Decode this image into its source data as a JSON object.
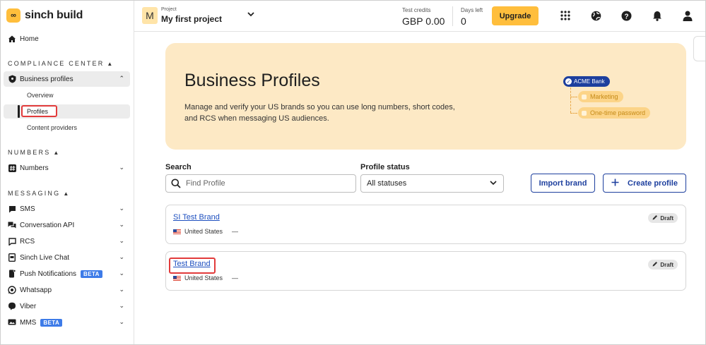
{
  "brand": {
    "logo_text": "sinch build",
    "accent": "#ffbe3c",
    "primary": "#1d3f9e"
  },
  "sidebar": {
    "home": "Home",
    "compliance_section": "COMPLIANCE CENTER",
    "business_profiles": "Business profiles",
    "overview": "Overview",
    "profiles": "Profiles",
    "content_providers": "Content providers",
    "numbers_section": "NUMBERS",
    "numbers": "Numbers",
    "messaging_section": "MESSAGING",
    "items": [
      "SMS",
      "Conversation API",
      "RCS",
      "Sinch Live Chat",
      "Push Notifications",
      "Whatsapp",
      "Viber",
      "MMS"
    ],
    "beta": "BETA"
  },
  "topbar": {
    "project_initial": "M",
    "project_label": "Project",
    "project_name": "My first project",
    "credits_label": "Test credits",
    "credits_value": "GBP 0.00",
    "days_label": "Days left",
    "days_value": "0",
    "upgrade": "Upgrade",
    "icons": [
      "apps-grid-icon",
      "globe-icon",
      "help-icon",
      "bell-icon",
      "user-icon"
    ]
  },
  "banner": {
    "title": "Business Profiles",
    "description": "Manage and verify your US brands so you can use long numbers, short codes, and RCS when messaging US audiences.",
    "brand_tag": "ACME Bank",
    "tags": [
      "Marketing",
      "One-time password"
    ]
  },
  "filters": {
    "search_label": "Search",
    "search_placeholder": "Find Profile",
    "status_label": "Profile status",
    "status_value": "All statuses"
  },
  "actions": {
    "import": "Import brand",
    "create": "Create profile"
  },
  "profiles": [
    {
      "name": "SI Test Brand",
      "country": "United States",
      "extra": "—",
      "status": "Draft"
    },
    {
      "name": "Test Brand",
      "country": "United States",
      "extra": "—",
      "status": "Draft"
    }
  ]
}
